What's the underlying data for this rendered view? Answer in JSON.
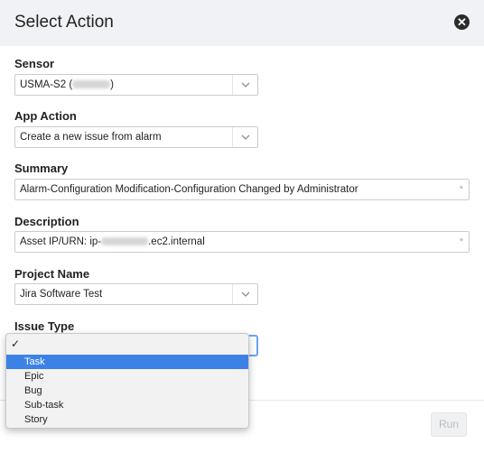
{
  "dialog": {
    "title": "Select Action"
  },
  "fields": {
    "sensor": {
      "label": "Sensor",
      "value": "USMA-S2 (",
      "value_suffix": ")"
    },
    "app_action": {
      "label": "App Action",
      "value": "Create a new issue from alarm"
    },
    "summary": {
      "label": "Summary",
      "value": "Alarm-Configuration Modification-Configuration Changed by Administrator",
      "required_mark": "*"
    },
    "description": {
      "label": "Description",
      "value_prefix": "Asset IP/URN: ip-",
      "value_suffix": ".ec2.internal",
      "required_mark": "*"
    },
    "project_name": {
      "label": "Project Name",
      "value": "Jira Software Test"
    },
    "issue_type": {
      "label": "Issue Type"
    }
  },
  "issue_type_dropdown": {
    "check_glyph": "✓",
    "options": [
      "Task",
      "Epic",
      "Bug",
      "Sub-task",
      "Story"
    ],
    "highlighted": "Task"
  },
  "footer": {
    "run_label": "Run"
  },
  "icons": {
    "close": "close-circle-icon",
    "chevron": "chevron-down-icon"
  }
}
